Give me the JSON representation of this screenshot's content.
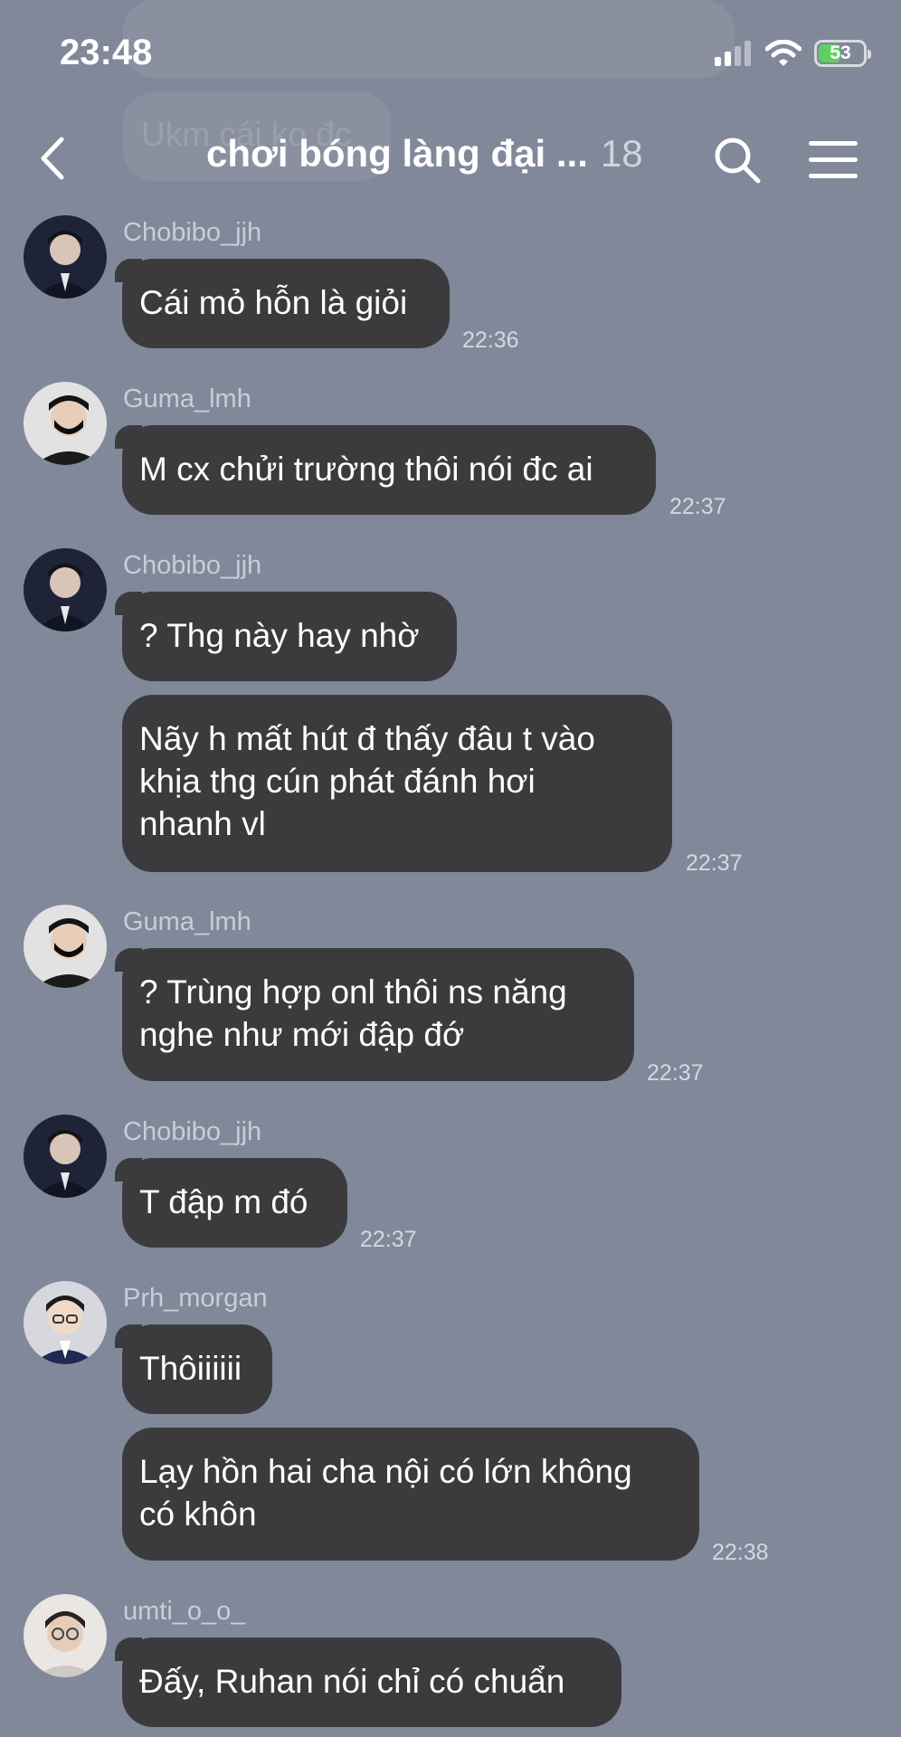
{
  "status": {
    "time": "23:48",
    "battery": "53"
  },
  "header": {
    "title": "chơi bóng làng đại ...",
    "member_count": "18"
  },
  "background": {
    "ghost_text": "Ukm cái ko đc"
  },
  "messages": [
    {
      "sender": "Chobibo_jjh",
      "text": "Cái mỏ hỗn là giỏi",
      "time": "22:36"
    },
    {
      "sender": "Guma_lmh",
      "text": "M cx chửi trường thôi nói đc ai",
      "time": "22:37"
    },
    {
      "sender": "Chobibo_jjh",
      "text": "? Thg này hay nhờ"
    },
    {
      "lines": [
        "Nãy h mất hút đ thấy đâu t vào",
        "khịa thg cún phát đánh hơi",
        "nhanh vl"
      ],
      "time": "22:37"
    },
    {
      "sender": "Guma_lmh",
      "lines": [
        "? Trùng hợp onl thôi ns năng",
        "nghe như mới đập đớ"
      ],
      "time": "22:37"
    },
    {
      "sender": "Chobibo_jjh",
      "text": "T đập m đó",
      "time": "22:37"
    },
    {
      "sender": "Prh_morgan",
      "text": "Thôiiiiii"
    },
    {
      "lines": [
        "Lạy hồn hai cha nội có lớn không",
        "có khôn"
      ],
      "time": "22:38"
    },
    {
      "sender": "umti_o_o_",
      "text": "Đấy, Ruhan nói chỉ có chuẩn"
    }
  ],
  "colors": {
    "background": "#818899",
    "bubble": "#3b3b3e",
    "battery_fill": "#5fcf62"
  },
  "icons": [
    "back-chevron-icon",
    "search-icon",
    "hamburger-menu-icon",
    "signal-icon",
    "wifi-icon",
    "battery-icon"
  ]
}
